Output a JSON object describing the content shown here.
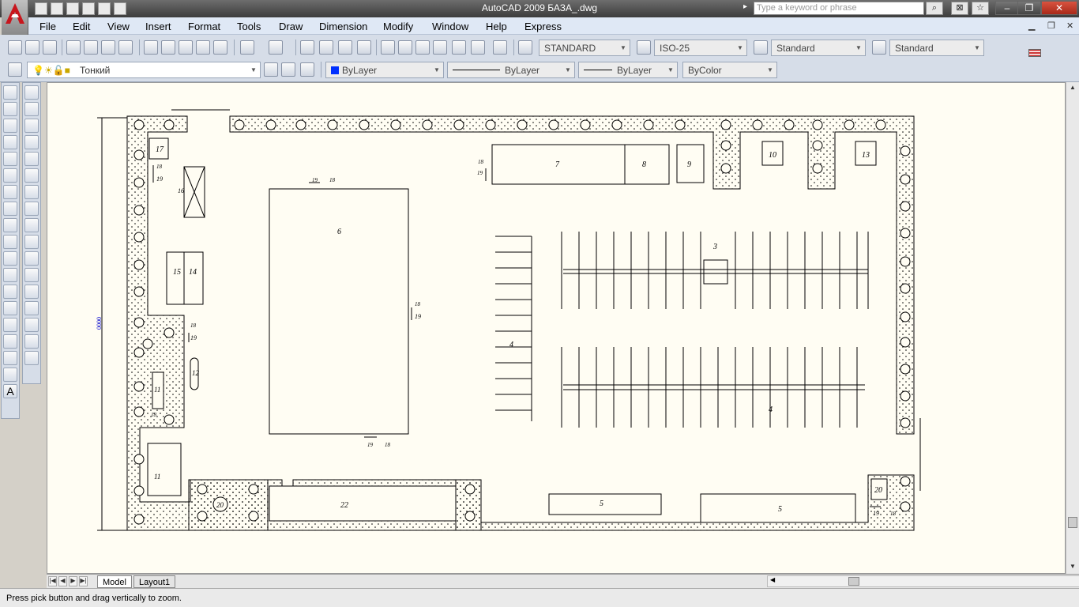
{
  "window": {
    "title": "AutoCAD 2009 БАЗА_.dwg",
    "search_placeholder": "Type a keyword or phrase",
    "minimize": "–",
    "restore": "❐",
    "close": "✕"
  },
  "menu": {
    "items": [
      "File",
      "Edit",
      "View",
      "Insert",
      "Format",
      "Tools",
      "Draw",
      "Dimension",
      "Modify",
      "Window",
      "Help",
      "Express"
    ]
  },
  "toolbar": {
    "text_style": "STANDARD",
    "dim_style": "ISO-25",
    "table_style": "Standard",
    "multileader_style": "Standard",
    "layer_name": "Тонкий",
    "color": "ByLayer",
    "linetype": "ByLayer",
    "lineweight": "ByLayer",
    "plot_style": "ByColor"
  },
  "layout_tabs": [
    "Model",
    "Layout1"
  ],
  "status": {
    "prompt": "Press pick button and drag vertically to zoom."
  },
  "drawing": {
    "labels": [
      "17",
      "18",
      "19",
      "16",
      "15",
      "14",
      "18",
      "19",
      "11",
      "12",
      "18",
      "11",
      "20",
      "22",
      "6",
      "19",
      "18",
      "18",
      "19",
      "7",
      "8",
      "9",
      "10",
      "13",
      "3",
      "4",
      "4",
      "5",
      "5",
      "20",
      "19",
      "18",
      "18",
      "19",
      "18",
      "19"
    ],
    "dimension_text": "0000"
  },
  "colors": {
    "canvas": "#fffdf3",
    "ribbon": "#d6dde8",
    "titlebar": "#4a4a4a"
  }
}
